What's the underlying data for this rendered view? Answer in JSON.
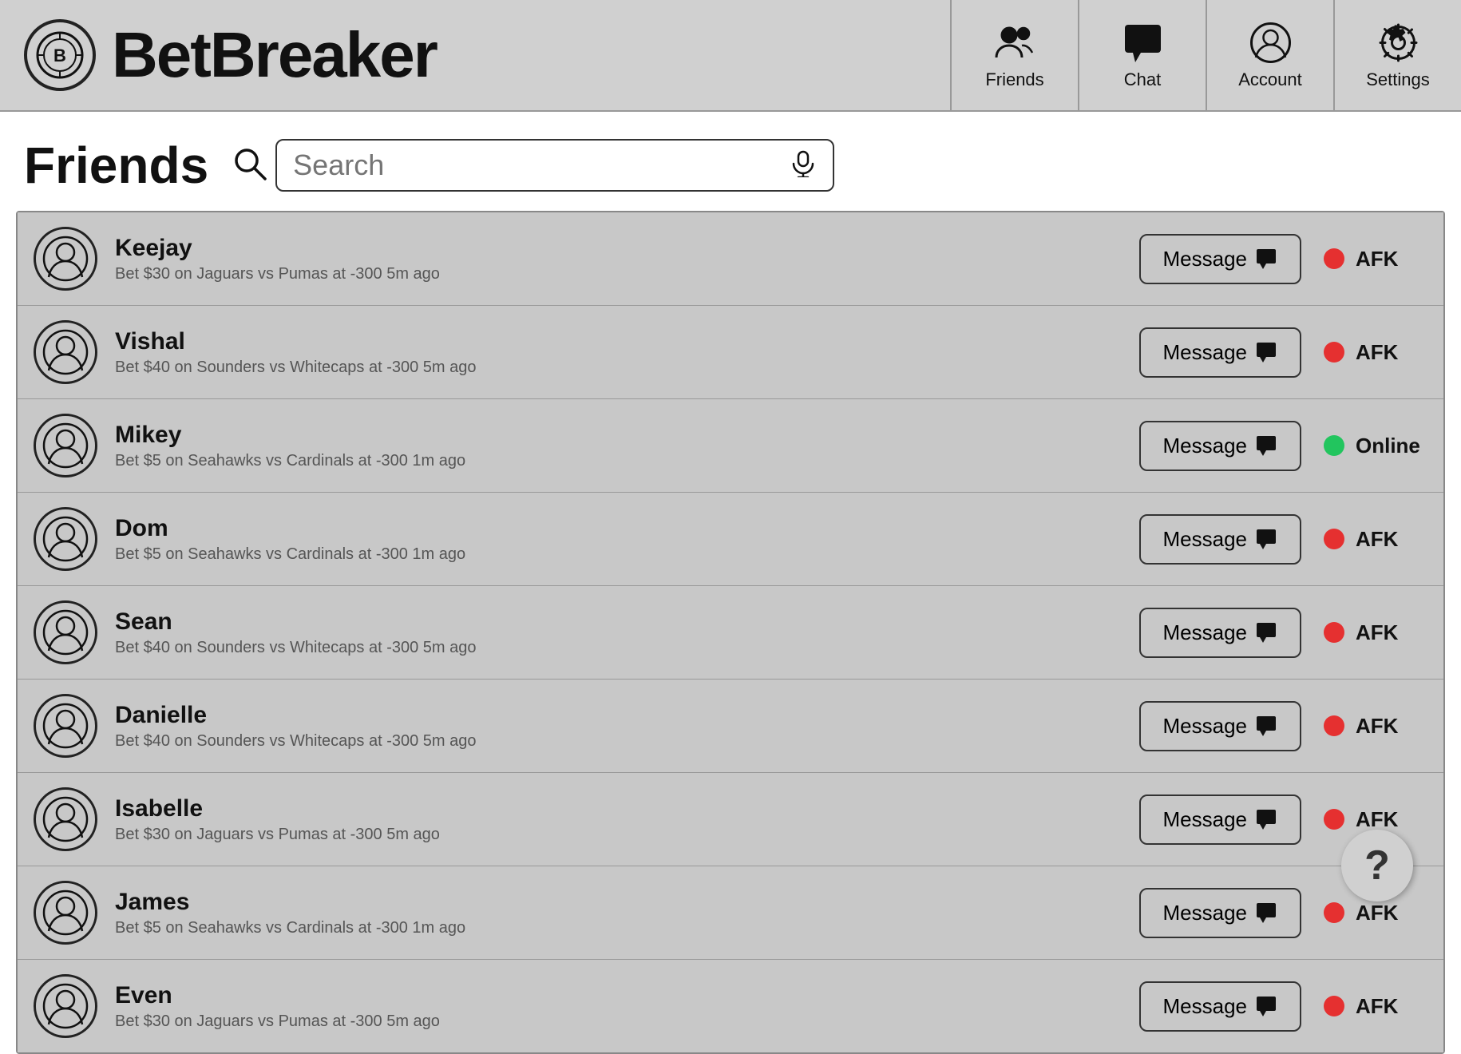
{
  "app": {
    "title": "BetBreaker",
    "logo_alt": "BetBreaker Logo"
  },
  "nav": {
    "items": [
      {
        "id": "friends",
        "label": "Friends",
        "icon": "friends-icon"
      },
      {
        "id": "chat",
        "label": "Chat",
        "icon": "chat-icon"
      },
      {
        "id": "account",
        "label": "Account",
        "icon": "account-icon"
      },
      {
        "id": "settings",
        "label": "Settings",
        "icon": "settings-icon"
      }
    ]
  },
  "friends_section": {
    "title": "Friends",
    "search_placeholder": "Search"
  },
  "friends": [
    {
      "name": "Keejay",
      "activity": "Bet $30 on Jaguars vs Pumas at -300 5m ago",
      "status": "AFK",
      "status_type": "red"
    },
    {
      "name": "Vishal",
      "activity": "Bet $40 on Sounders vs Whitecaps at -300 5m ago",
      "status": "AFK",
      "status_type": "red"
    },
    {
      "name": "Mikey",
      "activity": "Bet $5 on Seahawks vs Cardinals at -300 1m ago",
      "status": "Online",
      "status_type": "green"
    },
    {
      "name": "Dom",
      "activity": "Bet $5 on Seahawks vs Cardinals at -300 1m ago",
      "status": "AFK",
      "status_type": "red"
    },
    {
      "name": "Sean",
      "activity": "Bet $40 on Sounders vs Whitecaps at -300 5m ago",
      "status": "AFK",
      "status_type": "red"
    },
    {
      "name": "Danielle",
      "activity": "Bet $40 on Sounders vs Whitecaps at -300 5m ago",
      "status": "AFK",
      "status_type": "red"
    },
    {
      "name": "Isabelle",
      "activity": "Bet $30 on Jaguars vs Pumas at -300 5m ago",
      "status": "AFK",
      "status_type": "red"
    },
    {
      "name": "James",
      "activity": "Bet $5 on Seahawks vs Cardinals at -300 1m ago",
      "status": "AFK",
      "status_type": "red"
    },
    {
      "name": "Even",
      "activity": "Bet $30 on Jaguars vs Pumas at -300 5m ago",
      "status": "AFK",
      "status_type": "red"
    }
  ],
  "buttons": {
    "message_label": "Message",
    "help_label": "?"
  }
}
